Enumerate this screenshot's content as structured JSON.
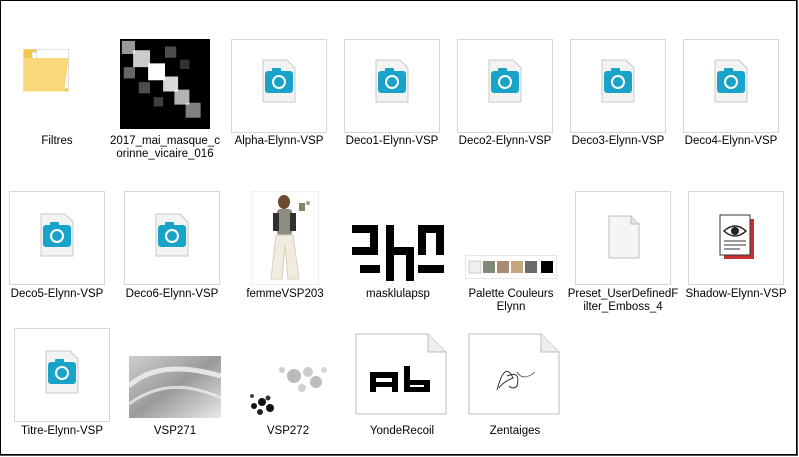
{
  "window": {
    "title": ""
  },
  "items": [
    {
      "name": "Filtres",
      "type": "folder"
    },
    {
      "name": "2017_mai_masque_corinne_vicaire_016",
      "type": "image-mask"
    },
    {
      "name": "Alpha-Elynn-VSP",
      "type": "vsp-file"
    },
    {
      "name": "Deco1-Elynn-VSP",
      "type": "vsp-file"
    },
    {
      "name": "Deco2-Elynn-VSP",
      "type": "vsp-file"
    },
    {
      "name": "Deco3-Elynn-VSP",
      "type": "vsp-file"
    },
    {
      "name": "Deco4-Elynn-VSP",
      "type": "vsp-file"
    },
    {
      "name": "Deco5-Elynn-VSP",
      "type": "vsp-file"
    },
    {
      "name": "Deco6-Elynn-VSP",
      "type": "vsp-file"
    },
    {
      "name": "femmeVSP203",
      "type": "image-woman"
    },
    {
      "name": "masklulapsp",
      "type": "image-mask"
    },
    {
      "name": "Palette Couleurs Elynn",
      "type": "image-palette"
    },
    {
      "name": "Preset_UserDefinedFilter_Emboss_4",
      "type": "blank-file"
    },
    {
      "name": "Shadow-Elynn-VSP",
      "type": "shadow-file"
    },
    {
      "name": "Titre-Elynn-VSP",
      "type": "vsp-file"
    },
    {
      "name": "VSP271",
      "type": "image-gray"
    },
    {
      "name": "VSP272",
      "type": "image-dots"
    },
    {
      "name": "YondeRecoil",
      "type": "font-file",
      "preview": "Ab"
    },
    {
      "name": "Zentaiges",
      "type": "font-file",
      "preview": "Ab"
    }
  ],
  "colors": {
    "accent": "#1aa3c8",
    "shadow_red": "#c8312f"
  }
}
